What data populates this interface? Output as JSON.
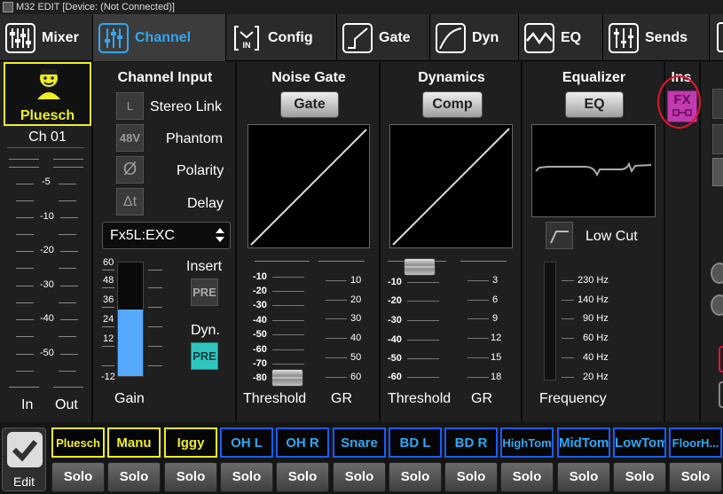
{
  "window": {
    "title": "M32 EDIT [Device: (Not Connected)]"
  },
  "tabs": [
    {
      "label": "Mixer",
      "icon": "mixer-icon"
    },
    {
      "label": "Channel",
      "icon": "channel-icon",
      "active": true
    },
    {
      "label": "Config",
      "icon": "config-icon"
    },
    {
      "label": "Gate",
      "icon": "gate-icon"
    },
    {
      "label": "Dyn",
      "icon": "dyn-icon"
    },
    {
      "label": "EQ",
      "icon": "eq-icon"
    },
    {
      "label": "Sends",
      "icon": "sends-icon"
    }
  ],
  "colors": {
    "accent": "#2ea8f5",
    "selected_channel": "#eeee22",
    "channel_blue": "#1a5cff",
    "fx_magenta": "#c03ab0",
    "gain_meter": "#55aaff",
    "insert_annotation": "#e0152b",
    "pre_teal": "#2fc6c0"
  },
  "channel_strip": {
    "name": "Pluesch",
    "number": "Ch 01",
    "icon": "singer-icon",
    "meter_ticks": [
      "-5",
      "-10",
      "-20",
      "-30",
      "-40",
      "-50"
    ],
    "in_label": "In",
    "out_label": "Out"
  },
  "channel_input": {
    "title": "Channel Input",
    "stereo_link": {
      "button": "L",
      "label": "Stereo Link"
    },
    "phantom": {
      "button": "48V",
      "label": "Phantom"
    },
    "polarity": {
      "button": "Ø",
      "label": "Polarity"
    },
    "delay": {
      "button": "Δt",
      "label": "Delay"
    },
    "source_select": "Fx5L:EXC",
    "insert": {
      "label": "Insert",
      "button": "PRE"
    },
    "dyn": {
      "label": "Dyn.",
      "button": "PRE"
    },
    "gain_ticks": [
      "60",
      "48",
      "36",
      "24",
      "12",
      "-12"
    ],
    "gain_label": "Gain",
    "gain_level_db": 30
  },
  "noise_gate": {
    "title": "Noise Gate",
    "button": "Gate",
    "threshold_ticks": [
      "-10",
      "-20",
      "-30",
      "-40",
      "-50",
      "-60",
      "-70",
      "-80"
    ],
    "gr_ticks": [
      "10",
      "20",
      "30",
      "40",
      "50",
      "60"
    ],
    "threshold_label": "Threshold",
    "gr_label": "GR",
    "threshold_db": -80
  },
  "dynamics": {
    "title": "Dynamics",
    "button": "Comp",
    "threshold_ticks": [
      "-10",
      "-20",
      "-30",
      "-40",
      "-50",
      "-60"
    ],
    "gr_ticks": [
      "3",
      "6",
      "9",
      "12",
      "15",
      "18"
    ],
    "threshold_label": "Threshold",
    "gr_label": "GR",
    "threshold_db": 0
  },
  "equalizer": {
    "title": "Equalizer",
    "button": "EQ",
    "low_cut_label": "Low Cut",
    "freq_ticks": [
      "230 Hz",
      "140 Hz",
      "90 Hz",
      "60 Hz",
      "40 Hz",
      "20 Hz"
    ],
    "frequency_label": "Frequency"
  },
  "insert": {
    "title": "Ins",
    "fx_button": "FX"
  },
  "bottom": {
    "edit_label": "Edit",
    "solo_label": "Solo",
    "channels": [
      "Pluesch",
      "Manu",
      "Iggy",
      "OH L",
      "OH R",
      "Snare",
      "BD L",
      "BD R",
      "HighTom",
      "MidTom",
      "LowTom",
      "FloorH..."
    ]
  }
}
